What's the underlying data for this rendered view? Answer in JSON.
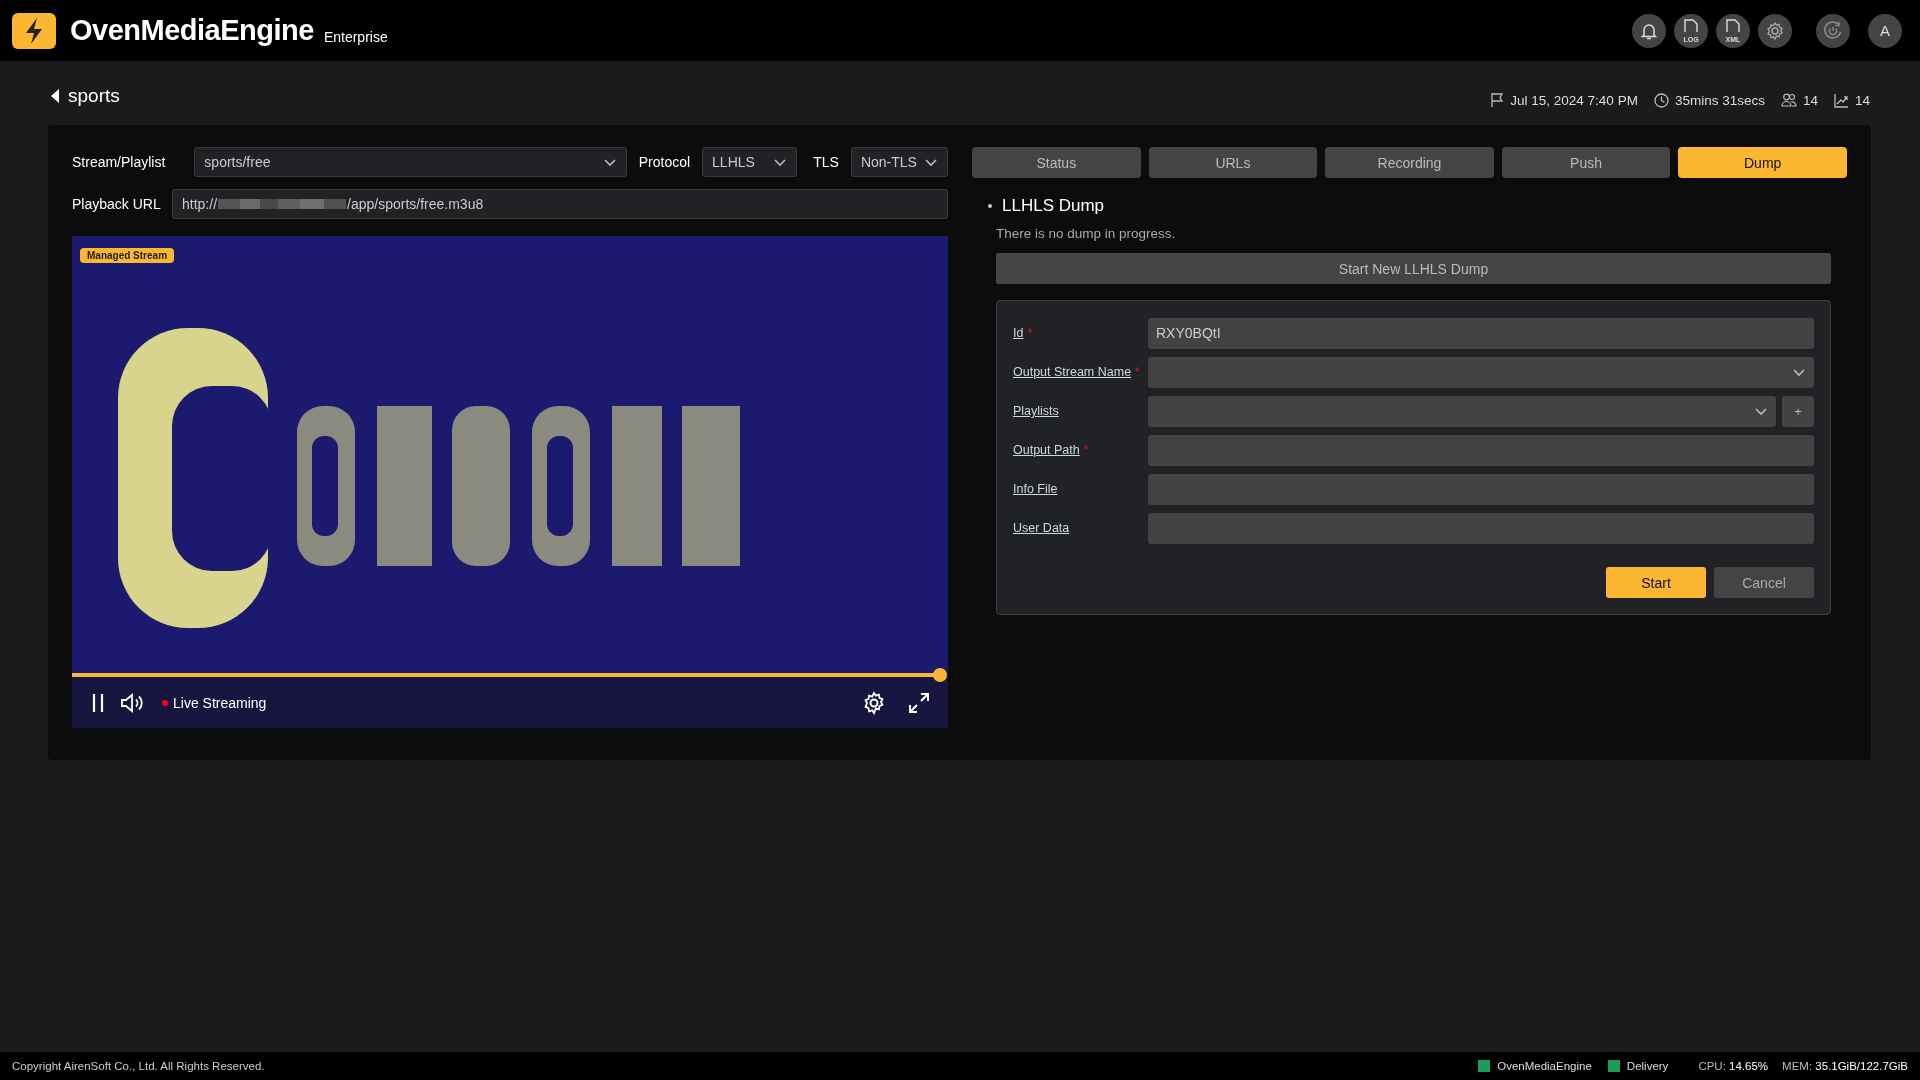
{
  "header": {
    "logo_text": "OvenMediaEngine",
    "edition": "Enterprise",
    "log_icon_text": "LOG",
    "xml_icon_text": "XML",
    "avatar": "A"
  },
  "stream": {
    "title": "sports",
    "started": "Jul 15, 2024 7:40 PM",
    "uptime": "35mins 31secs",
    "connections": "14",
    "max_connections": "14"
  },
  "player": {
    "stream_label": "Stream/Playlist",
    "stream_value": "sports/free",
    "protocol_label": "Protocol",
    "protocol_value": "LLHLS",
    "tls_label": "TLS",
    "tls_value": "Non-TLS",
    "playback_label": "Playback URL",
    "playback_url_start": "http://",
    "playback_url_end": "/app/sports/free.m3u8",
    "badge": "Managed Stream",
    "live_label": "Live Streaming",
    "playing": true,
    "progress": {
      "level": 1
    }
  },
  "tabs": [
    {
      "label": "Status",
      "selected": false
    },
    {
      "label": "URLs",
      "selected": false
    },
    {
      "label": "Recording",
      "selected": false
    },
    {
      "label": "Push",
      "selected": false
    },
    {
      "label": "Dump",
      "selected": true
    }
  ],
  "dump": {
    "title": "LLHLS Dump",
    "status": "There is no dump in progress.",
    "start_new_button": "Start New LLHLS Dump",
    "required_mark": "*",
    "fields": [
      {
        "kind": "text",
        "label": "Id",
        "required": true,
        "value": "RXY0BQtI"
      },
      {
        "kind": "select",
        "label": "Output Stream Name",
        "required": true
      },
      {
        "kind": "select_add",
        "label": "Playlists",
        "required": false,
        "add_label": "+"
      },
      {
        "kind": "text",
        "label": "Output Path",
        "required": true
      },
      {
        "kind": "text",
        "label": "Info File",
        "required": false
      },
      {
        "kind": "text",
        "label": "User Data",
        "required": false
      }
    ],
    "buttons": [
      {
        "label": "Start",
        "kind": "primary"
      },
      {
        "label": "Cancel",
        "kind": "secondary"
      }
    ]
  },
  "footer": {
    "copyright": "Copyright AirenSoft Co., Ltd. All Rights Reserved.",
    "services": [
      {
        "name": "OvenMediaEngine",
        "color": "#1a9c5a"
      },
      {
        "name": "Delivery",
        "color": "#1a9c5a"
      }
    ],
    "cpu_label": "CPU:",
    "cpu_value": "14.65%",
    "mem_label": "MEM:",
    "mem_value": "35.1GiB/122.7GiB"
  }
}
